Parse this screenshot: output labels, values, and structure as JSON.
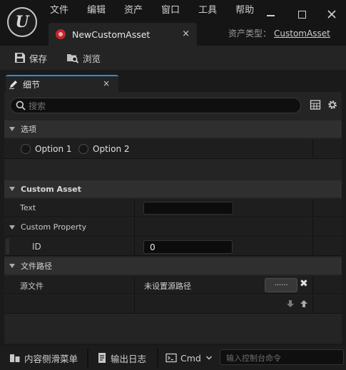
{
  "menu": [
    "文件",
    "编辑",
    "资产",
    "窗口",
    "工具",
    "帮助"
  ],
  "logo_text": "U",
  "asset_tab": {
    "label": "NewCustomAsset",
    "close": "×"
  },
  "asset_type": {
    "label": "资产类型：",
    "value": "CustomAsset"
  },
  "toolbar": {
    "save_label": "保存",
    "browse_label": "浏览"
  },
  "details_tab": {
    "label": "细节",
    "close": "×"
  },
  "search": {
    "placeholder": "搜索"
  },
  "sections": {
    "options": {
      "title": "选项",
      "radio_options": [
        "Option 1",
        "Option 2"
      ]
    },
    "custom_asset": {
      "title": "Custom Asset",
      "text_label": "Text",
      "text_value": "",
      "custom_property_label": "Custom Property",
      "id_label": "ID",
      "id_value": "0"
    },
    "file_path": {
      "title": "文件路径",
      "source_label": "源文件",
      "source_value": "未设置源路径",
      "pick_button": "......",
      "clear": "✖"
    }
  },
  "statusbar": {
    "content_drawer": "内容侧滑菜单",
    "output_log": "输出日志",
    "cmd": "Cmd",
    "console_placeholder": "输入控制台命令"
  },
  "colors": {
    "accent_blue": "#2d8fd8",
    "asset_red": "#c3272b"
  }
}
